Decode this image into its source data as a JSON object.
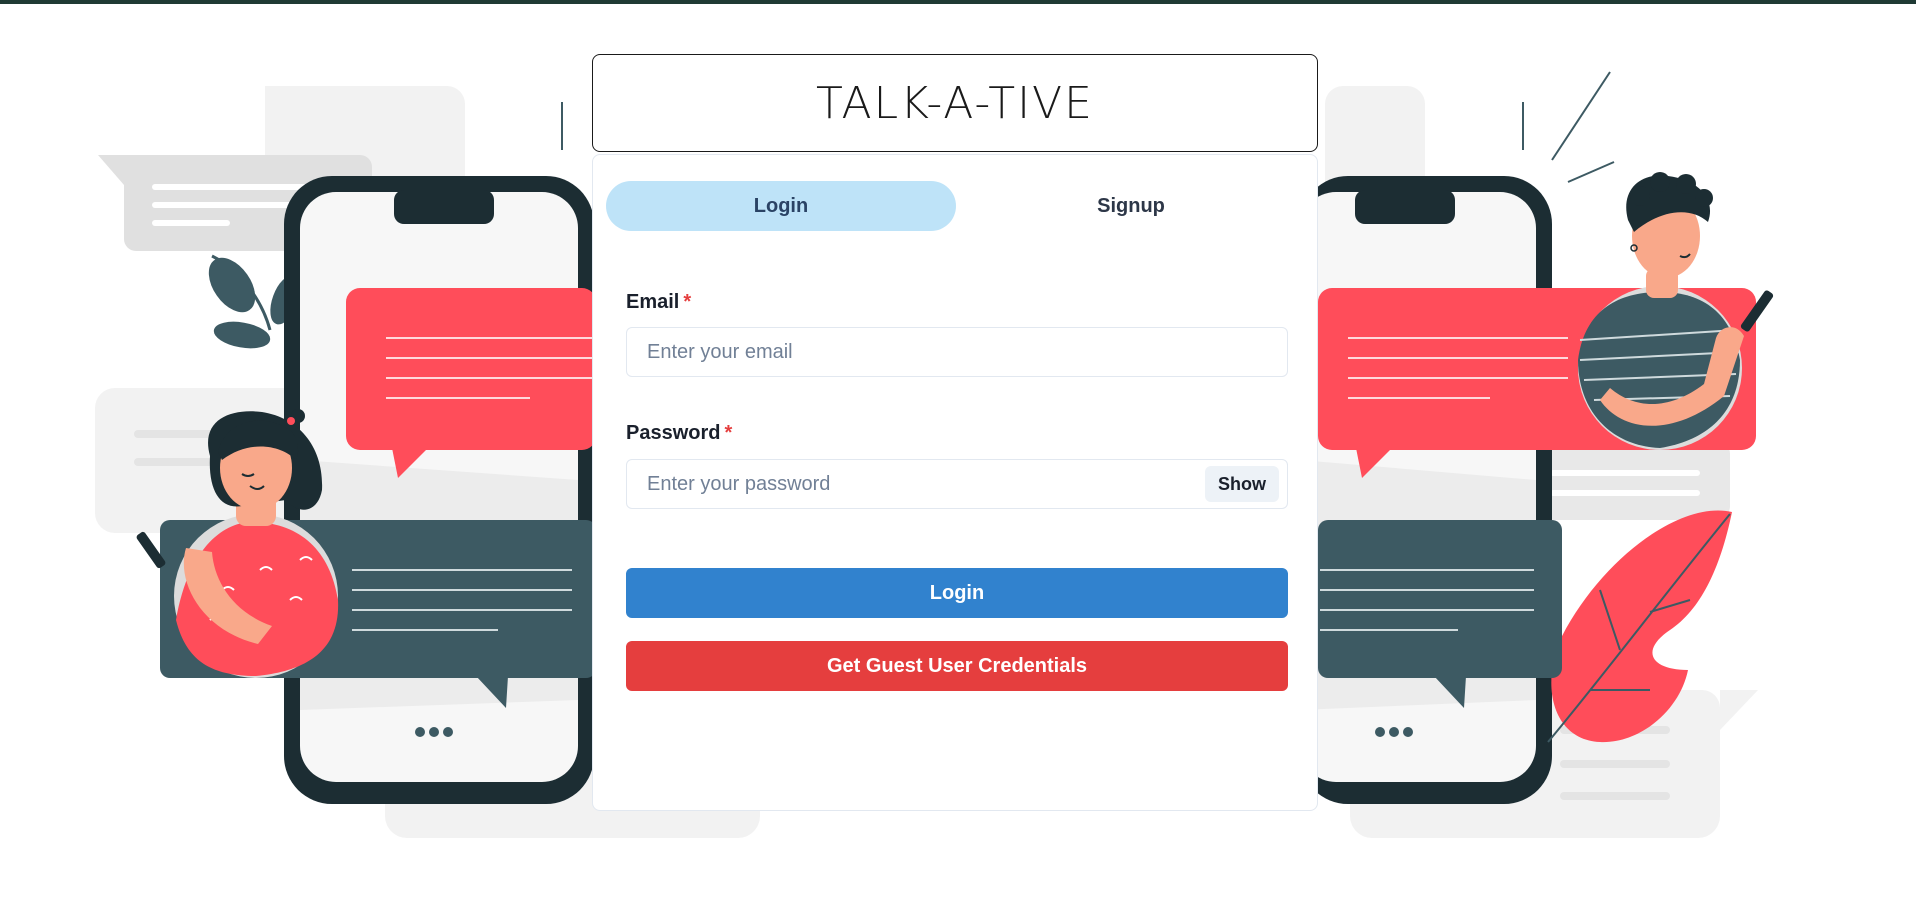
{
  "app": {
    "title": "TALK-A-TIVE"
  },
  "tabs": [
    {
      "label": "Login",
      "active": true
    },
    {
      "label": "Signup",
      "active": false
    }
  ],
  "form": {
    "email_label": "Email",
    "email_placeholder": "Enter your email",
    "email_value": "",
    "password_label": "Password",
    "password_placeholder": "Enter your password",
    "password_value": "",
    "required_marker": "*",
    "show_label": "Show",
    "login_label": "Login",
    "guest_label": "Get Guest User Credentials"
  },
  "colors": {
    "top_bar": "#1f3a34",
    "tab_active_bg": "#bee3f8",
    "login_button": "#3182ce",
    "guest_button": "#e53e3e",
    "illustration_red": "#ff4d5a",
    "illustration_dark": "#3d5a63",
    "phone_frame": "#1c2d33"
  },
  "icons": [
    "typing-dots-icon",
    "woman-avatar-illustration",
    "man-avatar-illustration",
    "leaf-illustration"
  ]
}
